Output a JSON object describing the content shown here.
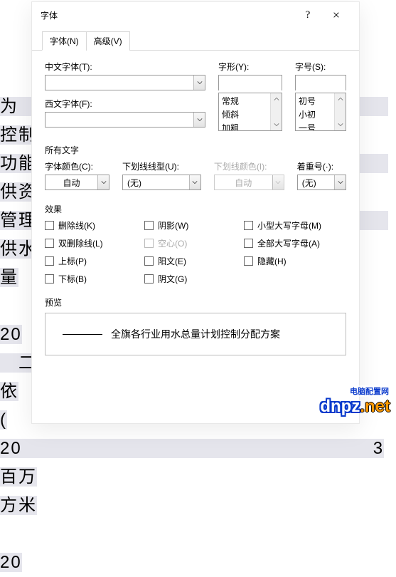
{
  "dialog": {
    "title": "字体",
    "help": "?",
    "close": "×"
  },
  "tabs": {
    "font": "字体(N)",
    "advanced": "高级(V)"
  },
  "labels": {
    "cjkFont": "中文字体(T):",
    "westFont": "西文字体(F):",
    "fontStyle": "字形(Y):",
    "fontSize": "字号(S):",
    "allText": "所有文字",
    "fontColor": "字体颜色(C):",
    "underlineStyle": "下划线线型(U):",
    "underlineColor": "下划线颜色(I):",
    "emphasis": "着重号(·):",
    "effects": "效果",
    "preview": "预览"
  },
  "values": {
    "cjkFont": "",
    "westFont": "",
    "fontStyle": "",
    "fontSize": "",
    "fontColor": "自动",
    "underlineStyle": "(无)",
    "underlineColor": "自动",
    "emphasis": "(无)"
  },
  "styleList": [
    "常规",
    "倾斜",
    "加粗"
  ],
  "sizeList": [
    "初号",
    "小初",
    "一号"
  ],
  "effects": {
    "strike": "删除线(K)",
    "dblStrike": "双删除线(L)",
    "superscript": "上标(P)",
    "subscript": "下标(B)",
    "shadow": "阴影(W)",
    "outline": "空心(O)",
    "emboss": "阳文(E)",
    "engrave": "阴文(G)",
    "smallCaps": "小型大写字母(M)",
    "allCaps": "全部大写字母(A)",
    "hidden": "隐藏(H)"
  },
  "previewText": "全旗各行业用水总量计划控制分配方案",
  "bgText": {
    "l1": "为　　　　　　　　　　　　　　　　　　　　控制",
    "l2": "功能　　　　　　　　　　　　　　　　　　　供资",
    "l3": "管理　　　　　　　　　　　　　　　　　　　供水",
    "l4": "量",
    "l5": "20",
    "l6": "　二",
    "l7": "依",
    "l8": "(",
    "l9": "20　　　　　　　　　　　　　　　　　　　3 百万",
    "l10": "方米",
    "l11": "20"
  },
  "watermark": {
    "logo": "dnpz",
    "sub": "电脑配置网",
    "domain": ".net"
  }
}
